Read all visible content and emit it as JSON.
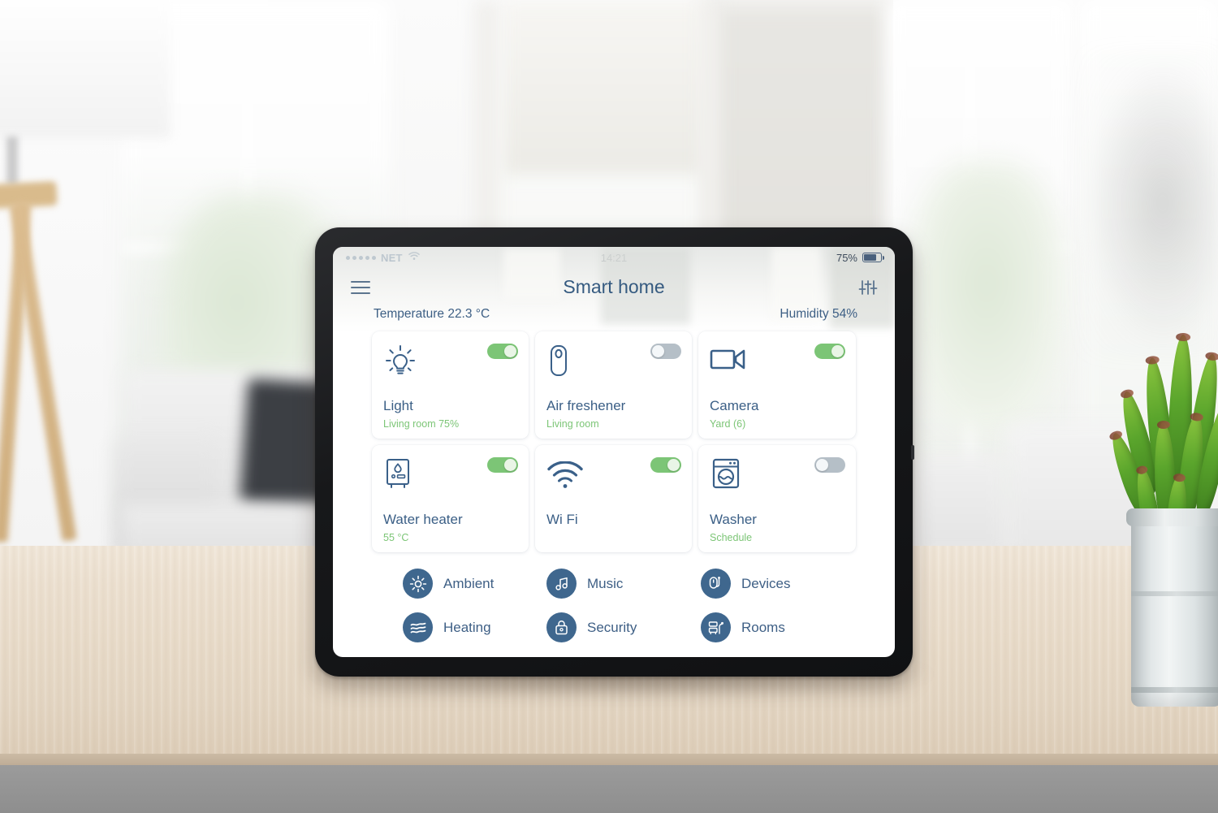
{
  "scene": {
    "description": "tablet on light wood table in blurred bright living room",
    "table_color": "#e8dbc9",
    "plant": "jade-plant-in-galvanized-bucket"
  },
  "status_bar": {
    "carrier": "NET",
    "signal_dots": 5,
    "wifi_icon": "wifi-icon",
    "time": "14:21",
    "battery_percent": "75%",
    "battery_level": 75
  },
  "header": {
    "menu_icon": "hamburger-icon",
    "title": "Smart home",
    "settings_icon": "sliders-icon"
  },
  "readouts": {
    "temperature": "Temperature 22.3 °C",
    "humidity": "Humidity 54%"
  },
  "colors": {
    "accent_blue": "#3a6089",
    "toggle_on": "#7cc576",
    "toggle_off": "#b5bfc7",
    "subtitle_green": "#7cc576",
    "badge_blue": "#3f678e"
  },
  "cards": [
    {
      "icon": "lightbulb-icon",
      "title": "Light",
      "subtitle": "Living room 75%",
      "toggle": "on"
    },
    {
      "icon": "air-freshener-icon",
      "title": "Air freshener",
      "subtitle": "Living room",
      "toggle": "off"
    },
    {
      "icon": "camera-icon",
      "title": "Camera",
      "subtitle": "Yard (6)",
      "toggle": "on"
    },
    {
      "icon": "water-heater-icon",
      "title": "Water heater",
      "subtitle": "55 °C",
      "toggle": "on"
    },
    {
      "icon": "wifi-icon",
      "title": "Wi Fi",
      "subtitle": "",
      "toggle": "on"
    },
    {
      "icon": "washer-icon",
      "title": "Washer",
      "subtitle": "Schedule",
      "toggle": "off"
    }
  ],
  "menu": [
    {
      "icon": "sun-icon",
      "label": "Ambient"
    },
    {
      "icon": "music-icon",
      "label": "Music"
    },
    {
      "icon": "devices-icon",
      "label": "Devices"
    },
    {
      "icon": "waves-icon",
      "label": "Heating"
    },
    {
      "icon": "lock-icon",
      "label": "Security"
    },
    {
      "icon": "rooms-icon",
      "label": "Rooms"
    }
  ]
}
